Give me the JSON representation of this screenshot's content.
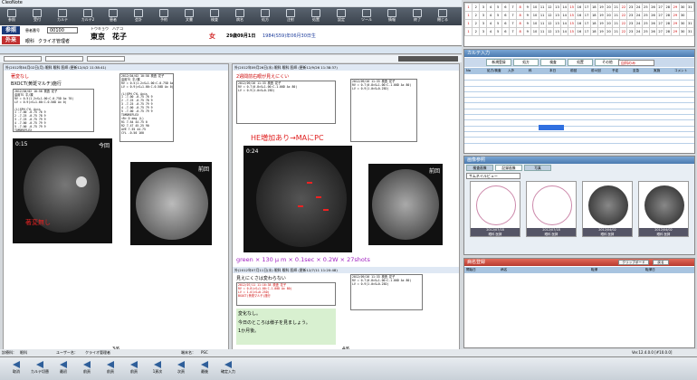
{
  "window": {
    "title": "CleoNote"
  },
  "toolbar": {
    "buttons": [
      "参照",
      "受付",
      "カルテ",
      "カルテ2",
      "患者",
      "会計",
      "予約",
      "文書",
      "検査",
      "病名",
      "処方",
      "注射",
      "処置",
      "設定",
      "ツール",
      "情報",
      "終了",
      "閉じる"
    ]
  },
  "patient": {
    "visit_type": "参照",
    "dept_tag": "外来",
    "id_label": "患者番号",
    "id": "00100",
    "kana": "トウキョウ　ハナコ",
    "name": "東京　花子",
    "gender": "女",
    "age": "29歳09月1日",
    "birth": "1984(S59)年06月30日生",
    "dept": "眼科",
    "doctor": "クライオ管理者"
  },
  "left_page": {
    "header": "外)2012年04月02日(月) 眼科 眼科 医師 (更新12/4/2 11:38:41)",
    "line1": "著変なし",
    "line2": "BXOCT(黄斑マルチ)施行",
    "note": "2012/04/02 10:58 検査 花子\n遠用TS 平/裸\nRV = 0.5(1.2×S+1.00:C-0.75D Ax 70)\nLV = 0.9(×S+1.00:C-0.50D Ax 0)\n\n(L)SPH CYL Axis\n1 -7.00 -0.75 76 9\n2 -7.25 -0.75 78 9\n3 -7.25 -0.75 79 9\n4 -7.00 -0.75 79 9\n5 -7.00 -0.75 79 9\nTOMOREFLEX\n<R> D deg (L)\nR1 7.64 44.75 0\nR2 7.47 45.25 90\nAVE 7.55 44.75\nCYL -0.50 160",
    "img_time": "0:15",
    "img_label": "今回",
    "img2_label": "前回",
    "img_note": "著変無し",
    "page_count": "3/6"
  },
  "right_page": {
    "header": "外)2012年09月26日(水) 眼科 眼科 医師 (更新12/9/26 11:38:37)",
    "line1": "2週間前右眼が見えにくい",
    "note_a": "2012/09/26 11:33 検査 花子\nRV = 0.7(0.8×S+1.00:C-1.00D Ax 80)\nLV = 0.9(1.0×S+0.25D)",
    "annotation": "HE増加あり→MAにPC",
    "img_time": "0:24",
    "img_label": "今回",
    "img2_label": "前回",
    "laser": "green × 130 μ m × 0.1sec × 0.2W × 27shots",
    "header2": "外)2012年07月11日(水) 眼科 眼科 医師 (更新12/7/11 11:20:48)",
    "line3": "見えにくさは変わらない",
    "note_c": "2012/07/11 11:16:38 検査 花子\nRV = 0.8(×S+1.00:C-1.00D Ax 80)\nLV = 1.0(×S+0.25D)\nBXOCT(黄斑マルチ)施行",
    "closing1": "変化なし。",
    "closing2": "今日のところは様子を見ましょう。",
    "closing3": "1か月後。",
    "page_count": "4/6"
  },
  "calendar": {
    "rows": [
      [
        "1",
        "2",
        "3",
        "4",
        "5",
        "6",
        "7",
        "8",
        "9",
        "10",
        "11",
        "12",
        "13",
        "14",
        "15",
        "16",
        "17",
        "18",
        "19",
        "20",
        "21",
        "22",
        "23",
        "24",
        "25",
        "26",
        "27",
        "28",
        "29",
        "30",
        "31"
      ],
      [
        "1",
        "2",
        "3",
        "4",
        "5",
        "6",
        "7",
        "8",
        "9",
        "10",
        "11",
        "12",
        "13",
        "14",
        "15",
        "16",
        "17",
        "18",
        "19",
        "20",
        "21",
        "22",
        "23",
        "24",
        "25",
        "26",
        "27",
        "28",
        "29",
        "30"
      ],
      [
        "1",
        "2",
        "3",
        "4",
        "5",
        "6",
        "7",
        "8",
        "9",
        "10",
        "11",
        "12",
        "13",
        "14",
        "15",
        "16",
        "17",
        "18",
        "19",
        "20",
        "21",
        "22",
        "23",
        "24",
        "25",
        "26",
        "27",
        "28",
        "29",
        "30",
        "31"
      ],
      [
        "1",
        "2",
        "3",
        "4",
        "5",
        "6",
        "7",
        "8",
        "9",
        "10",
        "11",
        "12",
        "13",
        "14",
        "15",
        "16",
        "17",
        "18",
        "19",
        "20",
        "21",
        "22",
        "23",
        "24",
        "25",
        "26",
        "27",
        "28",
        "29",
        "30",
        "31"
      ]
    ]
  },
  "karte_set": {
    "title": "カルテ入力",
    "tabs": [
      "新規登録",
      "処方",
      "検査",
      "処置",
      "その他"
    ],
    "filter": "自科のみ",
    "columns": [
      "No",
      "処方/検査",
      "入外",
      "科",
      "本日",
      "前回",
      "前々回",
      "予定",
      "至急",
      "実施",
      "コメント"
    ]
  },
  "thumbs": {
    "title": "画像参照",
    "tabs": [
      "検査画像",
      "記録画像",
      "写真"
    ],
    "select": "サムネイルビュー",
    "items": [
      {
        "date": "2012/07/18",
        "dept": "眼科 医師"
      },
      {
        "date": "2012/07/18",
        "dept": "眼科 医師"
      },
      {
        "date": "2012/04/02",
        "dept": "眼科 医師"
      },
      {
        "date": "2012/04/02",
        "dept": "眼科 医師"
      }
    ]
  },
  "order": {
    "title": "病名登録",
    "btn1": "クリップボード",
    "btn2": "戻る",
    "columns": [
      "開始日",
      "病名",
      "転帰",
      "転帰日"
    ]
  },
  "status": {
    "user_label": "診療科：",
    "user": "眼科",
    "user2_label": "ユーザー名：",
    "user2": "クライオ管理者",
    "term_label": "端末名：",
    "term": "PSC",
    "version": "Ver.12.4.0.0 [#10.0.0]"
  },
  "bottom_buttons": [
    "取消",
    "カルテ切替",
    "最初",
    "前頁",
    "前頁",
    "前頁",
    "1頁次",
    "次頁",
    "最後",
    "確定入力"
  ]
}
